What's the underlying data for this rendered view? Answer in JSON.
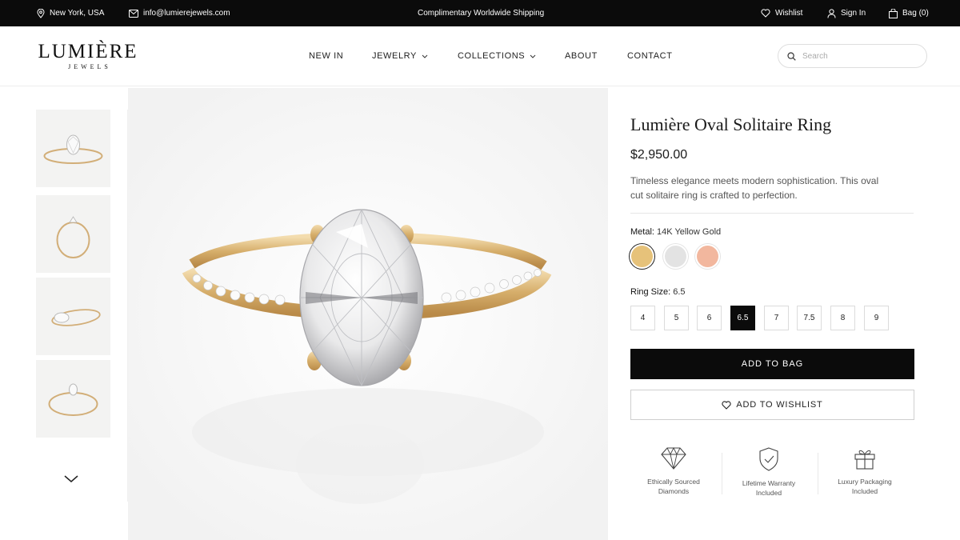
{
  "topbar": {
    "location": "New York, USA",
    "email": "info@lumierejewels.com",
    "promo": "Complimentary Worldwide Shipping",
    "wishlist": "Wishlist",
    "sign_in": "Sign In",
    "bag": "Bag (0)"
  },
  "header": {
    "logo_main": "LUMIÈRE",
    "logo_sub": "JEWELS",
    "nav": {
      "new_in": "NEW IN",
      "jewelry": "JEWELRY",
      "collections": "COLLECTIONS",
      "about": "ABOUT",
      "contact": "CONTACT"
    },
    "search_placeholder": "Search"
  },
  "product": {
    "title": "Lumière Oval Solitaire Ring",
    "price": "$2,950.00",
    "description": "Timeless elegance meets modern sophistication. This oval cut solitaire ring is crafted to perfection.",
    "metal_label": "Metal:",
    "metal_value": "14K Yellow Gold",
    "metals": [
      {
        "color": "#e6c27a",
        "selected": true
      },
      {
        "color": "#e3e3e3",
        "selected": false
      },
      {
        "color": "#f2b79e",
        "selected": false
      }
    ],
    "size_label": "Ring Size:",
    "size_value": "6.5",
    "sizes": [
      "4",
      "5",
      "6",
      "6.5",
      "7",
      "7.5",
      "8",
      "9"
    ],
    "selected_size": "6.5",
    "add_to_bag": "ADD TO BAG",
    "add_to_wishlist": "ADD TO WISHLIST"
  },
  "features": [
    {
      "icon": "diamond-icon",
      "text": "Ethically Sourced\nDiamonds"
    },
    {
      "icon": "shield-check-icon",
      "text": "Lifetime Warranty\nIncluded"
    },
    {
      "icon": "gift-icon",
      "text": "Luxury Packaging\nIncluded"
    }
  ],
  "colors": {
    "topbar_bg": "#0b0b0b",
    "gold": "#d6ae6b",
    "button_black": "#0b0b0b"
  }
}
